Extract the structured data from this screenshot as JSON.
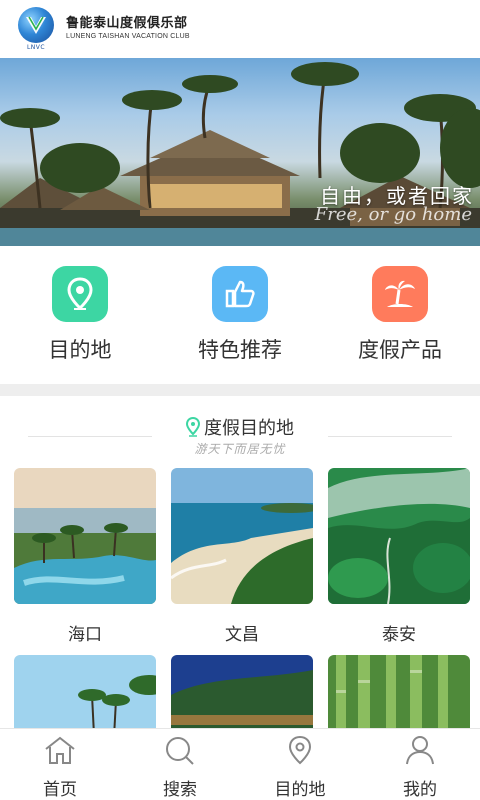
{
  "header": {
    "logo_text": "LNVC",
    "title_cn": "鲁能泰山度假俱乐部",
    "title_en": "LUNENG TAISHAN VACATION CLUB"
  },
  "banner": {
    "slogan": "自由，或者回家",
    "slogan_en": "Free, or go home"
  },
  "categories": [
    {
      "label": "目的地",
      "icon": "location-pin-icon",
      "color": "#3dd6a3"
    },
    {
      "label": "特色推荐",
      "icon": "thumbs-up-icon",
      "color": "#5bb8f5"
    },
    {
      "label": "度假产品",
      "icon": "palm-island-icon",
      "color": "#ff7b5c"
    }
  ],
  "section": {
    "title": "度假目的地",
    "subtitle": "游天下而居无忧"
  },
  "destinations": [
    {
      "name": "海口"
    },
    {
      "name": "文昌"
    },
    {
      "name": "泰安"
    }
  ],
  "nav": [
    {
      "label": "首页",
      "icon": "home-icon"
    },
    {
      "label": "搜索",
      "icon": "search-icon"
    },
    {
      "label": "目的地",
      "icon": "location-pin-icon"
    },
    {
      "label": "我的",
      "icon": "user-icon"
    }
  ]
}
